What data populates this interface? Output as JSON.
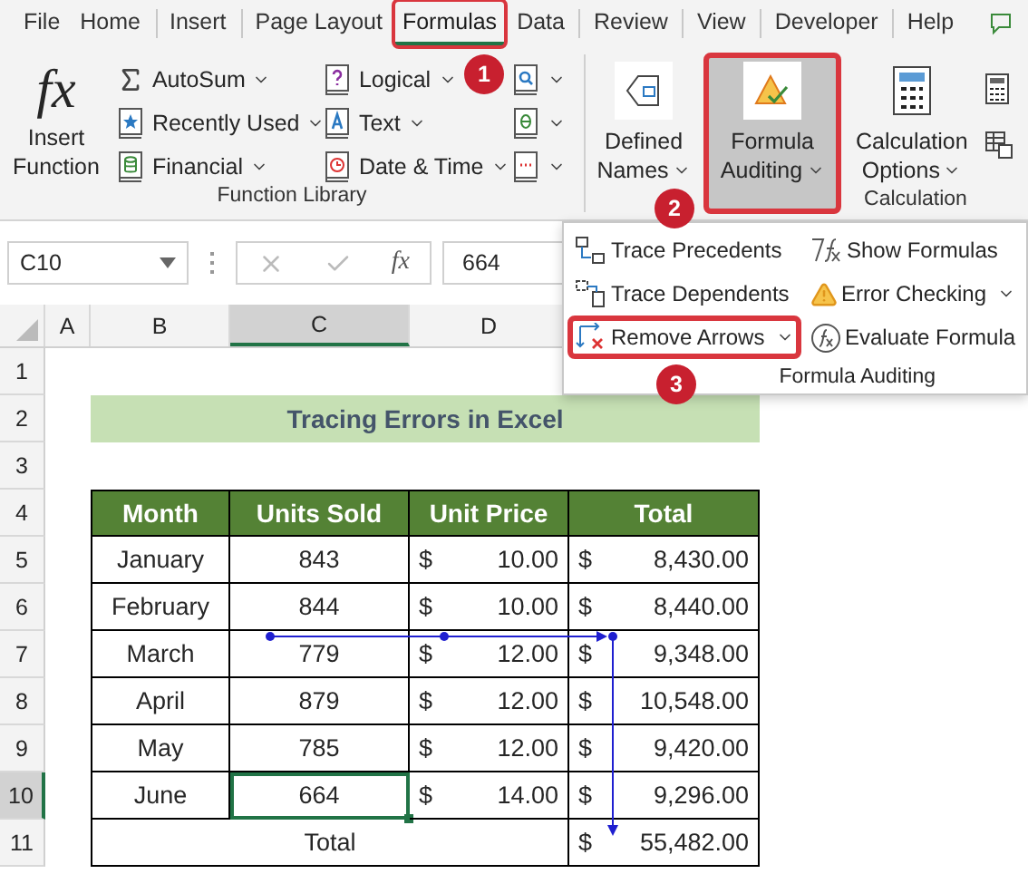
{
  "menu_tabs": [
    {
      "label": "File",
      "selected": false,
      "highlighted": false
    },
    {
      "label": "Home",
      "selected": false,
      "highlighted": false
    },
    {
      "label": "Insert",
      "selected": false,
      "highlighted": false
    },
    {
      "label": "Page Layout",
      "selected": false,
      "highlighted": false
    },
    {
      "label": "Formulas",
      "selected": true,
      "highlighted": true
    },
    {
      "label": "Data",
      "selected": false,
      "highlighted": false
    },
    {
      "label": "Review",
      "selected": false,
      "highlighted": false
    },
    {
      "label": "View",
      "selected": false,
      "highlighted": false
    },
    {
      "label": "Developer",
      "selected": false,
      "highlighted": false
    },
    {
      "label": "Help",
      "selected": false,
      "highlighted": false
    }
  ],
  "function_library": {
    "insert_function": {
      "icon": "fx",
      "lines": [
        "Insert",
        "Function"
      ]
    },
    "command_columns": [
      [
        {
          "label": "AutoSum",
          "kind": "sigma",
          "dropdown": true
        },
        {
          "label": "Recently Used",
          "kind": "star",
          "dropdown": true
        },
        {
          "label": "Financial",
          "kind": "database",
          "dropdown": true
        }
      ],
      [
        {
          "label": "Logical",
          "kind": "question",
          "dropdown": true
        },
        {
          "label": "Text",
          "kind": "letter",
          "dropdown": true
        },
        {
          "label": "Date & Time",
          "kind": "clock",
          "dropdown": true
        }
      ]
    ],
    "group_label": "Function Library"
  },
  "defined_names": {
    "lines": [
      "Defined",
      "Names"
    ],
    "dropdown": true
  },
  "formula_auditing": {
    "lines": [
      "Formula",
      "Auditing"
    ],
    "dropdown": true,
    "selected": true,
    "highlighted": true
  },
  "calculation": {
    "lines": [
      "Calculation",
      "Options"
    ],
    "dropdown": true,
    "group_label": "Calculation"
  },
  "formula_bar": {
    "name_box": "C10",
    "fx": "fx",
    "value": "664"
  },
  "column_headers": [
    {
      "label": "A",
      "selected": false
    },
    {
      "label": "B",
      "selected": false
    },
    {
      "label": "C",
      "selected": true
    },
    {
      "label": "D",
      "selected": false
    }
  ],
  "row_headers": [
    {
      "label": "1",
      "selected": false
    },
    {
      "label": "2",
      "selected": false
    },
    {
      "label": "3",
      "selected": false
    },
    {
      "label": "4",
      "selected": false
    },
    {
      "label": "5",
      "selected": false
    },
    {
      "label": "6",
      "selected": false
    },
    {
      "label": "7",
      "selected": false
    },
    {
      "label": "8",
      "selected": false
    },
    {
      "label": "9",
      "selected": false
    },
    {
      "label": "10",
      "selected": true
    },
    {
      "label": "11",
      "selected": false
    }
  ],
  "sheet": {
    "title": "Tracing Errors in Excel",
    "columns": [
      "Month",
      "Units Sold",
      "Unit Price",
      "Total"
    ],
    "rows": [
      {
        "month": "January",
        "units": "843",
        "price_currency": "$",
        "price": "10.00",
        "total_currency": "$",
        "total": "8,430.00",
        "units_selected": false
      },
      {
        "month": "February",
        "units": "844",
        "price_currency": "$",
        "price": "10.00",
        "total_currency": "$",
        "total": "8,440.00",
        "units_selected": false
      },
      {
        "month": "March",
        "units": "779",
        "price_currency": "$",
        "price": "12.00",
        "total_currency": "$",
        "total": "9,348.00",
        "units_selected": false
      },
      {
        "month": "April",
        "units": "879",
        "price_currency": "$",
        "price": "12.00",
        "total_currency": "$",
        "total": "10,548.00",
        "units_selected": false
      },
      {
        "month": "May",
        "units": "785",
        "price_currency": "$",
        "price": "12.00",
        "total_currency": "$",
        "total": "9,420.00",
        "units_selected": false
      },
      {
        "month": "June",
        "units": "664",
        "price_currency": "$",
        "price": "14.00",
        "total_currency": "$",
        "total": "9,296.00",
        "units_selected": true
      }
    ],
    "total_row": {
      "label": "Total",
      "currency": "$",
      "value": "55,482.00"
    }
  },
  "auditing_menu": {
    "items": [
      {
        "label": "Trace Precedents",
        "kind": "precedents",
        "dropdown": false,
        "highlighted": false
      },
      {
        "label": "Show Formulas",
        "kind": "formulas",
        "dropdown": false,
        "highlighted": false
      },
      {
        "label": "Trace Dependents",
        "kind": "dependents",
        "dropdown": false,
        "highlighted": false
      },
      {
        "label": "Error Checking",
        "kind": "warning",
        "dropdown": true,
        "highlighted": false
      },
      {
        "label": "Remove Arrows",
        "kind": "remove",
        "dropdown": true,
        "highlighted": true
      },
      {
        "label": "Evaluate Formula",
        "kind": "evaluate",
        "dropdown": false,
        "highlighted": false
      }
    ],
    "group_label": "Formula Auditing"
  },
  "callouts": [
    {
      "number": "1"
    },
    {
      "number": "2"
    },
    {
      "number": "3"
    }
  ]
}
